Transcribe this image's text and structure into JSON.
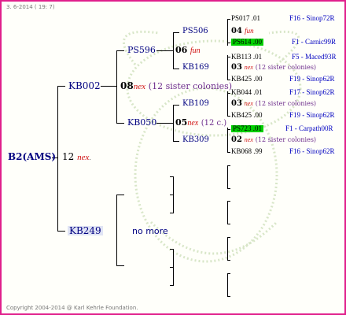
{
  "header": {
    "date": "3. 6-2014 ( 19: 7)"
  },
  "footer": {
    "copyright": "Copyright 2004-2014 @ Karl Kehrle Foundation."
  },
  "root": {
    "id": "B2(AMS)",
    "year": "12",
    "mark": "nex",
    "dot": "."
  },
  "gen1": [
    {
      "id": "KB002",
      "year": "08",
      "mark": "nex",
      "note": "(12 sister colonies)"
    },
    {
      "id": "KB249",
      "note": "no more"
    }
  ],
  "gen2": [
    {
      "id": "PS596",
      "year": "06",
      "mark": "fun"
    },
    {
      "id": "KB050",
      "year": "05",
      "mark": "nex",
      "note": "(12 c.)"
    }
  ],
  "gen3": [
    {
      "id": "PS506",
      "year": "04",
      "mark": "fun"
    },
    {
      "id": "KB169",
      "year": "03",
      "mark": "nex",
      "note": "(12 sister colonies)"
    },
    {
      "id": "KB109",
      "year": "03",
      "mark": "nex",
      "note": "(12 sister colonies)"
    },
    {
      "id": "KB309",
      "year": "02",
      "mark": "nex",
      "note": "(12 sister colonies)"
    }
  ],
  "gen4": [
    {
      "id": "PS017",
      "year": ".01",
      "origin": "F16 - Sinop72R"
    },
    {
      "id": "PS614",
      "year": ".00",
      "origin": "F1 - Carnic99R"
    },
    {
      "id": "KB113",
      "year": ".01",
      "origin": "F5 - Maced93R"
    },
    {
      "id": "KB425",
      "year": ".00",
      "origin": "F19 - Sinop62R"
    },
    {
      "id": "KB044",
      "year": ".01",
      "origin": "F17 - Sinop62R"
    },
    {
      "id": "KB425",
      "year": ".00",
      "origin": "F19 - Sinop62R"
    },
    {
      "id": "PS723",
      "year": ".01",
      "origin": "F1 - Carpath00R"
    },
    {
      "id": "KB068",
      "year": ".99",
      "origin": "F16 - Sinop62R"
    }
  ],
  "colors": {
    "border": "#e0208c",
    "highlight": "#00d000",
    "origin": "#0000c0",
    "mark": "#d01010"
  }
}
